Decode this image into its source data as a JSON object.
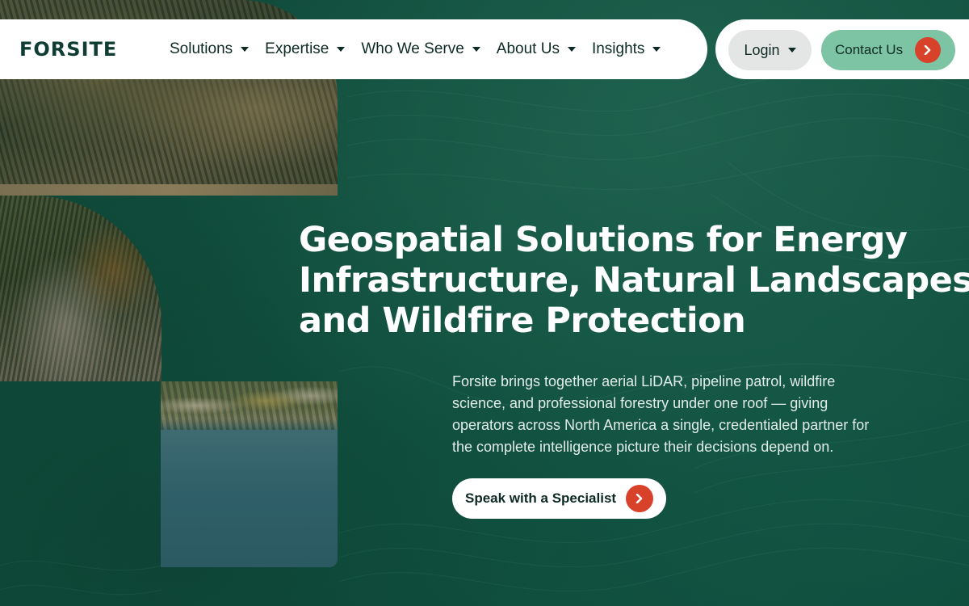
{
  "brand": {
    "logo_text": "FORSITE"
  },
  "nav": {
    "items": [
      {
        "label": "Solutions"
      },
      {
        "label": "Expertise"
      },
      {
        "label": "Who We Serve"
      },
      {
        "label": "About Us"
      },
      {
        "label": "Insights"
      }
    ],
    "login_label": "Login",
    "contact_label": "Contact Us"
  },
  "hero": {
    "headline_lines": [
      "Geospatial Solutions for Energy",
      "Infrastructure, Natural Landscapes",
      "and Wildfire Protection"
    ],
    "lede_lines": [
      "Forsite brings together aerial LiDAR, pipeline patrol, wildfire",
      "science, and professional forestry under one roof — giving",
      "operators across North America a single, credentialed partner for",
      "the complete intelligence picture their decisions depend on."
    ],
    "cta_label": "Speak with a Specialist"
  },
  "icons": {
    "dropdown": "chevron-down-icon",
    "arrow": "arrow-right-icon"
  },
  "colors": {
    "background": "#0f4a3c",
    "accent_green": "#7cc4a3",
    "accent_red": "#d8412a",
    "text_dark": "#0e2a24"
  }
}
